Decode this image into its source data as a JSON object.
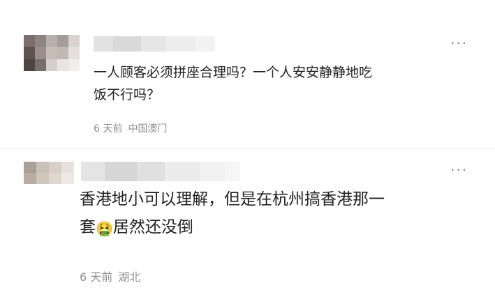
{
  "comments": [
    {
      "text_line1": "一人顾客必须拼座合理吗？一个人安安静静地吃",
      "text_line2": "饭不行吗？",
      "time": "6 天前",
      "location": "中国澳门",
      "more_label": "···"
    },
    {
      "text_before_emoji": "香港地小可以理解，但是在杭州搞香港那一",
      "text_line2_start": "套",
      "emoji": "🤮",
      "text_after_emoji": "居然还没倒",
      "time": "6 天前",
      "location": "湖北",
      "more_label": "···"
    }
  ],
  "colors": {
    "text": "#222222",
    "meta": "#8e8e8e",
    "divider": "#e8e8e8",
    "avatar1": [
      "#7c6f6b",
      "#8f8580",
      "#b8b0ac",
      "#a49c98",
      "#d9d2cf",
      "#5e524f",
      "#9b8d88",
      "#c7bcb8",
      "#c1b8b5",
      "#e4e0de",
      "#4e4543",
      "#7a6e6a",
      "#d5cfcc",
      "#e8e4e2",
      "#f0eeed"
    ],
    "avatar2": [
      "#a89f97",
      "#c9c0b8",
      "#d8d0c8",
      "#e6e1dc",
      "#b9aca1",
      "#d0c6bd",
      "#ded7d0",
      "#ece8e4"
    ]
  }
}
